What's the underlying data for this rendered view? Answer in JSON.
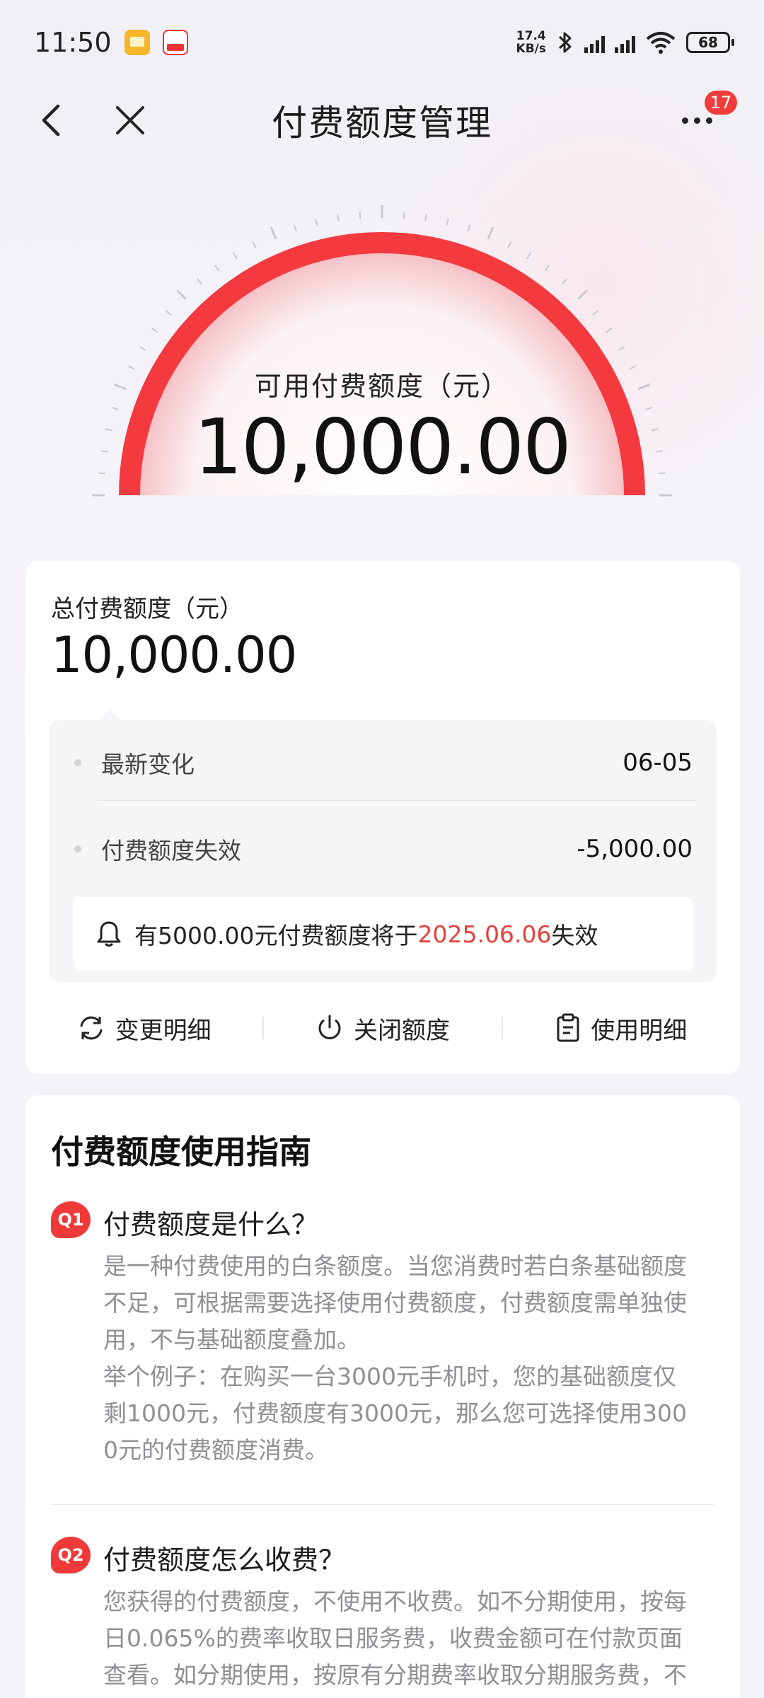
{
  "status_bar": {
    "time": "11:50",
    "net_speed_value": "17.4",
    "net_speed_unit": "KB/s",
    "battery": "68",
    "icons": [
      "gallery-app-icon",
      "shopping-app-icon",
      "bluetooth-icon",
      "signal-hd-icon",
      "signal-hd-icon",
      "wifi-icon",
      "battery-icon"
    ]
  },
  "nav": {
    "title": "付费额度管理",
    "badge_count": "17"
  },
  "gauge": {
    "label": "可用付费额度（元）",
    "value": "10,000.00",
    "ring_color": "#f33a3f"
  },
  "summary": {
    "total_label": "总付费额度（元）",
    "total_value": "10,000.00",
    "rows": [
      {
        "label": "最新变化",
        "value": "06-05"
      },
      {
        "label": "付费额度失效",
        "value": "-5,000.00"
      }
    ],
    "notice": {
      "prefix": "有5000.00元付费额度将于",
      "date": "2025.06.06",
      "suffix": "失效",
      "date_color": "#e5413b"
    },
    "actions": [
      {
        "label": "变更明细",
        "icon": "refresh-icon"
      },
      {
        "label": "关闭额度",
        "icon": "power-icon"
      },
      {
        "label": "使用明细",
        "icon": "clipboard-icon"
      }
    ]
  },
  "guide": {
    "title": "付费额度使用指南",
    "questions": [
      {
        "badge": "Q1",
        "title": "付费额度是什么？",
        "body_lines": [
          "是一种付费使用的白条额度。当您消费时若白条基础额度",
          "不足，可根据需要选择使用付费额度，付费额度需单独使",
          "用，不与基础额度叠加。",
          "举个例子：在购买一台3000元手机时，您的基础额度仅",
          "剩1000元，付费额度有3000元，那么您可选择使用300",
          "0元的付费额度消费。"
        ]
      },
      {
        "badge": "Q2",
        "title": "付费额度怎么收费？",
        "body_lines": [
          "您获得的付费额度，不使用不收费。如不分期使用，按每",
          "日0.065%的费率收取日服务费，收费金额可在付款页面",
          "查看。如分期使用，按原有分期费率收取分期服务费，不"
        ]
      }
    ]
  }
}
